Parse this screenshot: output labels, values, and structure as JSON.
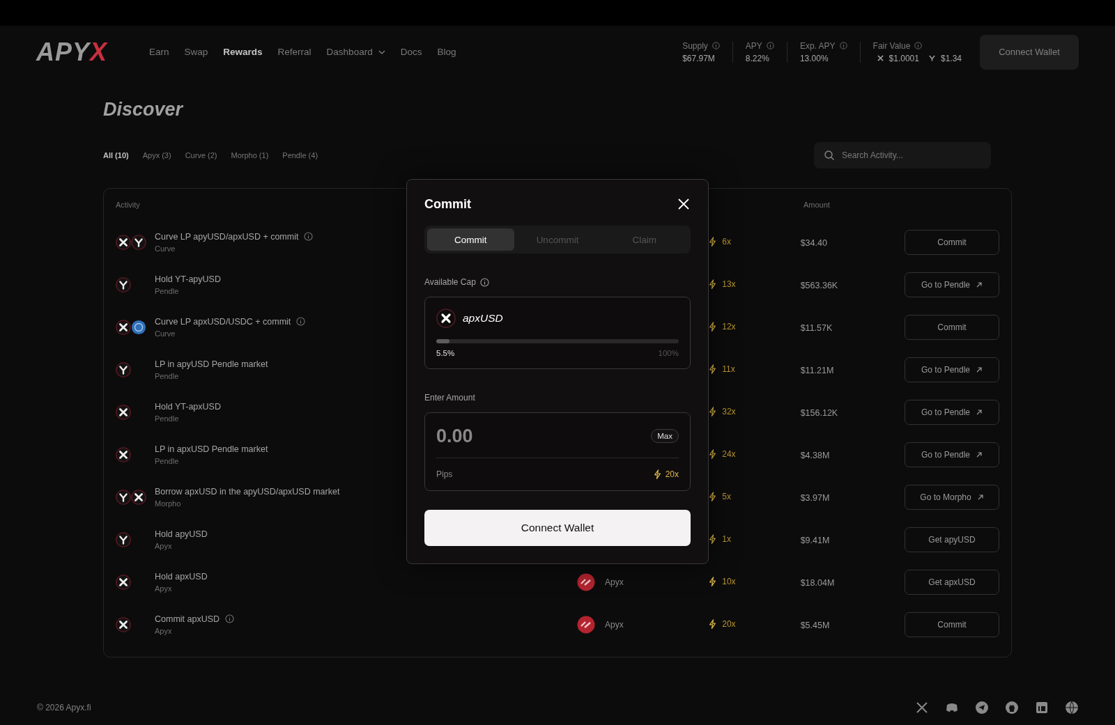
{
  "header": {
    "logo": {
      "main": "APY",
      "accent": "X"
    },
    "nav": [
      {
        "label": "Earn",
        "selected": false,
        "dropdown": false
      },
      {
        "label": "Swap",
        "selected": false,
        "dropdown": false
      },
      {
        "label": "Rewards",
        "selected": true,
        "dropdown": false
      },
      {
        "label": "Referral",
        "selected": false,
        "dropdown": false
      },
      {
        "label": "Dashboard",
        "selected": false,
        "dropdown": true
      },
      {
        "label": "Docs",
        "selected": false,
        "dropdown": false
      },
      {
        "label": "Blog",
        "selected": false,
        "dropdown": false
      }
    ],
    "stats": [
      {
        "label": "Supply",
        "value": "$67.97M"
      },
      {
        "label": "APY",
        "value": "8.22%"
      },
      {
        "label": "Exp. APY",
        "value": "13.00%"
      }
    ],
    "fair_value": {
      "label": "Fair Value",
      "prices": [
        {
          "kind": "x",
          "value": "$1.0001"
        },
        {
          "kind": "y",
          "value": "$1.34"
        }
      ]
    },
    "connect_button": "Connect Wallet"
  },
  "page_title": "Discover",
  "filters": [
    {
      "label": "All (10)",
      "selected": true
    },
    {
      "label": "Apyx (3)",
      "selected": false
    },
    {
      "label": "Curve (2)",
      "selected": false
    },
    {
      "label": "Morpho (1)",
      "selected": false
    },
    {
      "label": "Pendle (4)",
      "selected": false
    }
  ],
  "search": {
    "placeholder": "Search Activity..."
  },
  "table": {
    "columns": [
      "Activity",
      "Amount"
    ],
    "rows": [
      {
        "icons": [
          {
            "kind": "x"
          },
          {
            "kind": "y"
          }
        ],
        "title": "Curve LP apyUSD/apxUSD + commit",
        "info": true,
        "source": "Curve",
        "platform": null,
        "boost": "6x",
        "amount": "$34.40",
        "action": "Commit",
        "external": false
      },
      {
        "icons": [
          {
            "kind": "y"
          }
        ],
        "title": "Hold YT-apyUSD",
        "info": false,
        "source": "Pendle",
        "platform": null,
        "boost": "13x",
        "amount": "$563.36K",
        "action": "Go to Pendle",
        "external": true
      },
      {
        "icons": [
          {
            "kind": "x"
          },
          {
            "kind": "usdc"
          }
        ],
        "title": "Curve LP apxUSD/USDC + commit",
        "info": true,
        "source": "Curve",
        "platform": null,
        "boost": "12x",
        "amount": "$11.57K",
        "action": "Commit",
        "external": false
      },
      {
        "icons": [
          {
            "kind": "y"
          }
        ],
        "title": "LP in apyUSD Pendle market",
        "info": false,
        "source": "Pendle",
        "platform": null,
        "boost": "11x",
        "amount": "$11.21M",
        "action": "Go to Pendle",
        "external": true
      },
      {
        "icons": [
          {
            "kind": "x"
          }
        ],
        "title": "Hold YT-apxUSD",
        "info": false,
        "source": "Pendle",
        "platform": null,
        "boost": "32x",
        "amount": "$156.12K",
        "action": "Go to Pendle",
        "external": true
      },
      {
        "icons": [
          {
            "kind": "x"
          }
        ],
        "title": "LP in apxUSD Pendle market",
        "info": false,
        "source": "Pendle",
        "platform": null,
        "boost": "24x",
        "amount": "$4.38M",
        "action": "Go to Pendle",
        "external": true
      },
      {
        "icons": [
          {
            "kind": "y"
          },
          {
            "kind": "x"
          }
        ],
        "title": "Borrow apxUSD in the apyUSD/apxUSD market",
        "info": false,
        "source": "Morpho",
        "platform": null,
        "boost": "5x",
        "amount": "$3.97M",
        "action": "Go to Morpho",
        "external": true
      },
      {
        "icons": [
          {
            "kind": "y"
          }
        ],
        "title": "Hold apyUSD",
        "info": false,
        "source": "Apyx",
        "platform": null,
        "boost": "1x",
        "amount": "$9.41M",
        "action": "Get apyUSD",
        "external": false
      },
      {
        "icons": [
          {
            "kind": "x"
          }
        ],
        "title": "Hold apxUSD",
        "info": false,
        "source": "Apyx",
        "platform": "Apyx",
        "boost": "10x",
        "amount": "$18.04M",
        "action": "Get apxUSD",
        "external": false
      },
      {
        "icons": [
          {
            "kind": "x"
          }
        ],
        "title": "Commit apxUSD",
        "info": true,
        "source": "Apyx",
        "platform": "Apyx",
        "boost": "20x",
        "amount": "$5.45M",
        "action": "Commit",
        "external": false
      }
    ]
  },
  "footer": {
    "copyright": "© 2026 Apyx.fi",
    "socials": [
      {
        "kind": "x"
      },
      {
        "kind": "discord"
      },
      {
        "kind": "telegram"
      },
      {
        "kind": "github"
      },
      {
        "kind": "linkedin"
      },
      {
        "kind": "globe"
      }
    ]
  },
  "modal": {
    "title": "Commit",
    "tabs": [
      {
        "label": "Commit",
        "selected": true
      },
      {
        "label": "Uncommit",
        "selected": false
      },
      {
        "label": "Claim",
        "selected": false
      }
    ],
    "cap_label": "Available Cap",
    "cap": {
      "token": "apxUSD",
      "level": 0.055,
      "reading": "5.5%",
      "max": "100%"
    },
    "amount_label": "Enter Amount",
    "amount": {
      "placeholder": "0.00",
      "max_button": "Max",
      "pips_label": "Pips",
      "pips": "20x"
    },
    "submit": "Connect Wallet"
  }
}
